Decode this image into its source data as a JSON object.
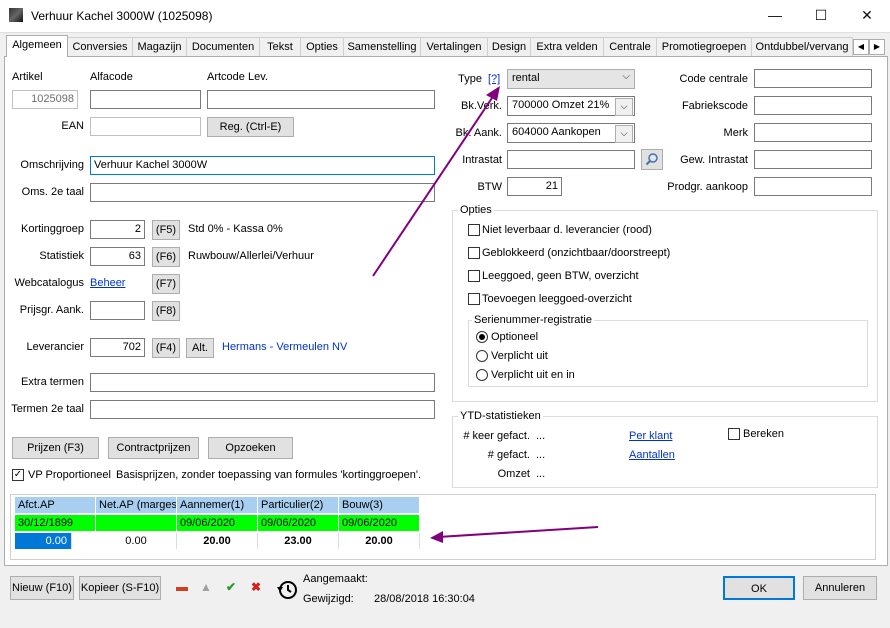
{
  "window": {
    "title": "Verhuur Kachel 3000W (1025098)",
    "minimize_glyph": "—",
    "maximize_glyph": "☐",
    "close_glyph": "✕"
  },
  "tabs": [
    "Algemeen",
    "Conversies",
    "Magazijn",
    "Documenten",
    "Tekst",
    "Opties",
    "Samenstelling",
    "Vertalingen",
    "Design",
    "Extra velden",
    "Centrale",
    "Promotiegroepen",
    "Ontdubbel/vervang"
  ],
  "tab_scroll": {
    "left": "◀",
    "right": "▶"
  },
  "left": {
    "artikel_label": "Artikel",
    "artikel_value": "1025098",
    "alfacode_label": "Alfacode",
    "alfacode_value": "",
    "artcode_label": "Artcode Lev.",
    "artcode_value": "",
    "ean_label": "EAN",
    "ean_value": "",
    "reg_button": "Reg. (Ctrl-E)",
    "omschrijving_label": "Omschrijving",
    "omschrijving_value": "Verhuur Kachel 3000W",
    "oms2_label": "Oms. 2e taal",
    "oms2_value": "",
    "kortinggroep_label": "Kortinggroep",
    "kortinggroep_value": "2",
    "f5": "(F5)",
    "kortinggroep_desc": "Std 0% - Kassa 0%",
    "statistiek_label": "Statistiek",
    "statistiek_value": "63",
    "f6": "(F6)",
    "statistiek_desc": "Ruwbouw/Allerlei/Verhuur",
    "webcatalogus_label": "Webcatalogus",
    "webcatalogus_link": "Beheer",
    "f7": "(F7)",
    "prijsgr_label": "Prijsgr. Aank.",
    "prijsgr_value": "",
    "f8": "(F8)",
    "leverancier_label": "Leverancier",
    "leverancier_value": "702",
    "f4": "(F4)",
    "alt": "Alt.",
    "leverancier_name": "Hermans - Vermeulen NV",
    "extra_termen_label": "Extra termen",
    "extra_termen_value": "",
    "termen2_label": "Termen 2e taal",
    "termen2_value": "",
    "prijzen_button": "Prijzen (F3)",
    "contractprijzen_button": "Contractprijzen",
    "opzoeken_button": "Opzoeken",
    "vp_label": "VP Proportioneel",
    "vp_checked": "✓",
    "vp_desc": "Basisprijzen, zonder toepassing van formules 'kortinggroepen'."
  },
  "right": {
    "type_label": "Type",
    "type_help": "[?]",
    "type_value": "rental",
    "bkverk_label": "Bk.Verk.",
    "bkverk_value": "700000 Omzet 21%",
    "bkaank_label": "Bk. Aank.",
    "bkaank_value": "604000 Aankopen",
    "intrastat_label": "Intrastat",
    "intrastat_value": "",
    "btw_label": "BTW",
    "btw_value": "21",
    "code_centrale_label": "Code centrale",
    "fabriekscode_label": "Fabriekscode",
    "merk_label": "Merk",
    "gew_intrastat_label": "Gew. Intrastat",
    "prodgr_label": "Prodgr. aankoop",
    "opties_title": "Opties",
    "opties": [
      "Niet leverbaar d. leverancier (rood)",
      "Geblokkeerd (onzichtbaar/doorstreept)",
      "Leeggoed, geen BTW, overzicht",
      "Toevoegen leeggoed-overzicht"
    ],
    "serienummer_title": "Serienummer-registratie",
    "serienummer_options": [
      "Optioneel",
      "Verplicht uit",
      "Verplicht uit en in"
    ],
    "serienummer_selected": "Optioneel",
    "ytd_title": "YTD-statistieken",
    "ytd_keer_label": "# keer gefact.",
    "ytd_gefact_label": "# gefact.",
    "ytd_omzet_label": "Omzet",
    "ytd_dots": "...",
    "per_klant_link": "Per klant",
    "aantallen_link": "Aantallen",
    "bereken_label": "Bereken"
  },
  "price_grid": {
    "headers": [
      "Afct.AP",
      "Net.AP (marges)",
      "Aannemer(1)",
      "Particulier(2)",
      "Bouw(3)"
    ],
    "dates": [
      "30/12/1899",
      "",
      "09/06/2020",
      "09/06/2020",
      "09/06/2020"
    ],
    "values": [
      "0.00",
      "0.00",
      "20.00",
      "23.00",
      "20.00"
    ]
  },
  "footer": {
    "nieuw_button": "Nieuw (F10)",
    "kopieer_button": "Kopieer (S-F10)",
    "aangemaakt_label": "Aangemaakt:",
    "aangemaakt_value": "",
    "gewijzigd_label": "Gewijzigd:",
    "gewijzigd_value": "28/08/2018 16:30:04",
    "ok_button": "OK",
    "annuleren_button": "Annuleren"
  },
  "colors": {
    "grid_header": "#a8cff0",
    "grid_green": "#00ff00",
    "selection": "#0078d7",
    "link": "#0033cc",
    "arrow": "#800080"
  }
}
